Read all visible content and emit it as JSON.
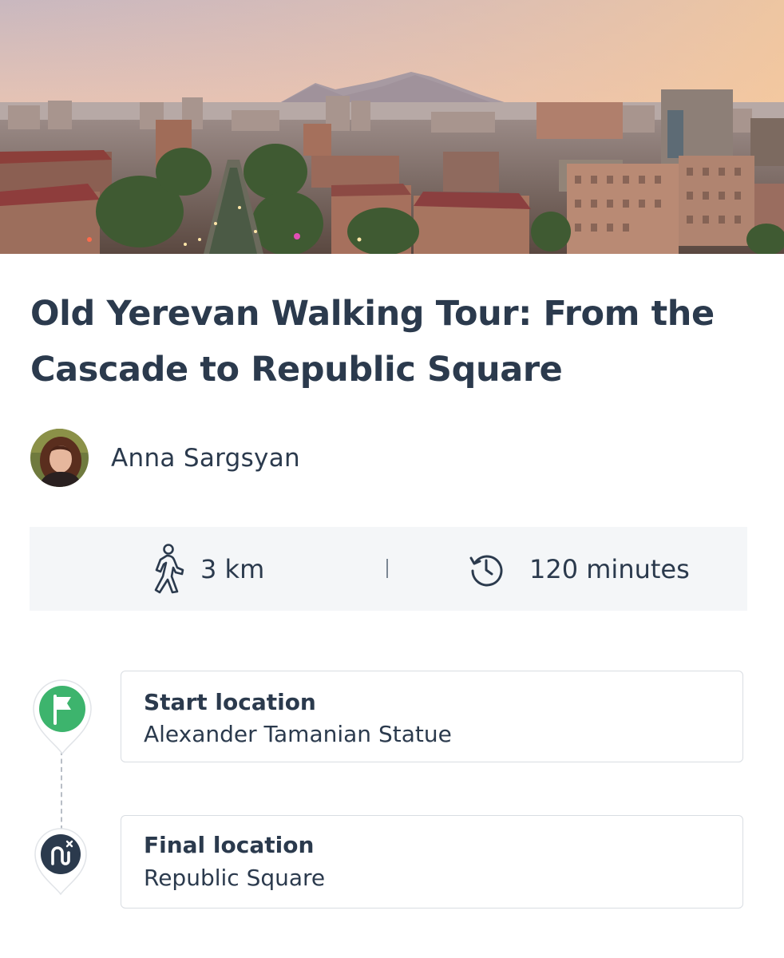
{
  "tour": {
    "title": "Old Yerevan Walking Tour: From the Cascade to Republic Square",
    "author": {
      "name": "Anna Sargsyan",
      "avatar_icon": "person-avatar"
    }
  },
  "stats": {
    "distance": "3 km",
    "distance_icon": "walking-person-icon",
    "duration": "120 minutes",
    "duration_icon": "clock-history-icon"
  },
  "locations": {
    "start": {
      "label": "Start location",
      "value": "Alexander Tamanian Statue",
      "icon": "flag-icon",
      "color": "#3db46d"
    },
    "end": {
      "label": "Final location",
      "value": "Republic Square",
      "icon": "route-end-icon",
      "color": "#2b3a4d"
    }
  },
  "colors": {
    "text": "#2b3a4d",
    "stats_background": "#f4f6f8",
    "card_border": "#d9dde2"
  }
}
